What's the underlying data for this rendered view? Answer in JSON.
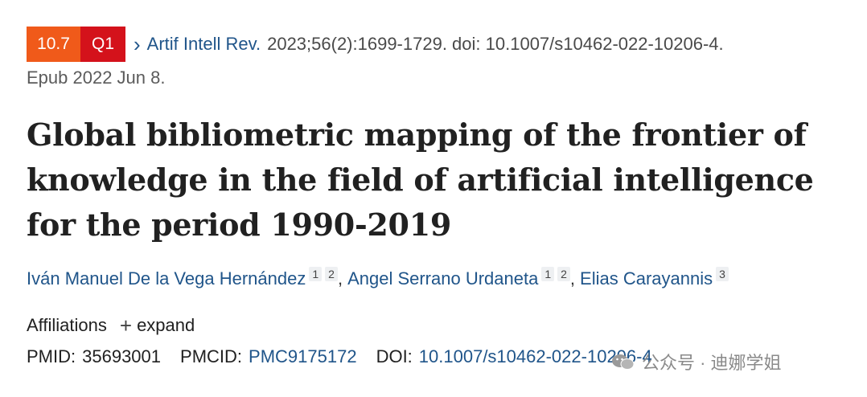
{
  "badge": {
    "impact": "10.7",
    "quartile": "Q1",
    "impact_color": "#f05a1a",
    "quartile_color": "#d4121b"
  },
  "citation": {
    "journal": "Artif Intell Rev.",
    "details": "2023;56(2):1699-1729. doi: 10.1007/s10462-022-10206-4.",
    "epub": "Epub 2022 Jun 8."
  },
  "title": "Global bibliometric mapping of the frontier of knowledge in the field of artificial intelligence for the period 1990-2019",
  "authors": [
    {
      "name": "Iván Manuel De la Vega Hernández",
      "affs": [
        "1",
        "2"
      ]
    },
    {
      "name": "Angel Serrano Urdaneta",
      "affs": [
        "1",
        "2"
      ]
    },
    {
      "name": "Elias Carayannis",
      "affs": [
        "3"
      ]
    }
  ],
  "affiliations": {
    "label": "Affiliations",
    "expand": "expand"
  },
  "ids": {
    "pmid_label": "PMID:",
    "pmid": "35693001",
    "pmcid_label": "PMCID:",
    "pmcid": "PMC9175172",
    "doi_label": "DOI:",
    "doi": "10.1007/s10462-022-10206-4"
  },
  "watermark": {
    "text": "公众号 · 迪娜学姐"
  }
}
